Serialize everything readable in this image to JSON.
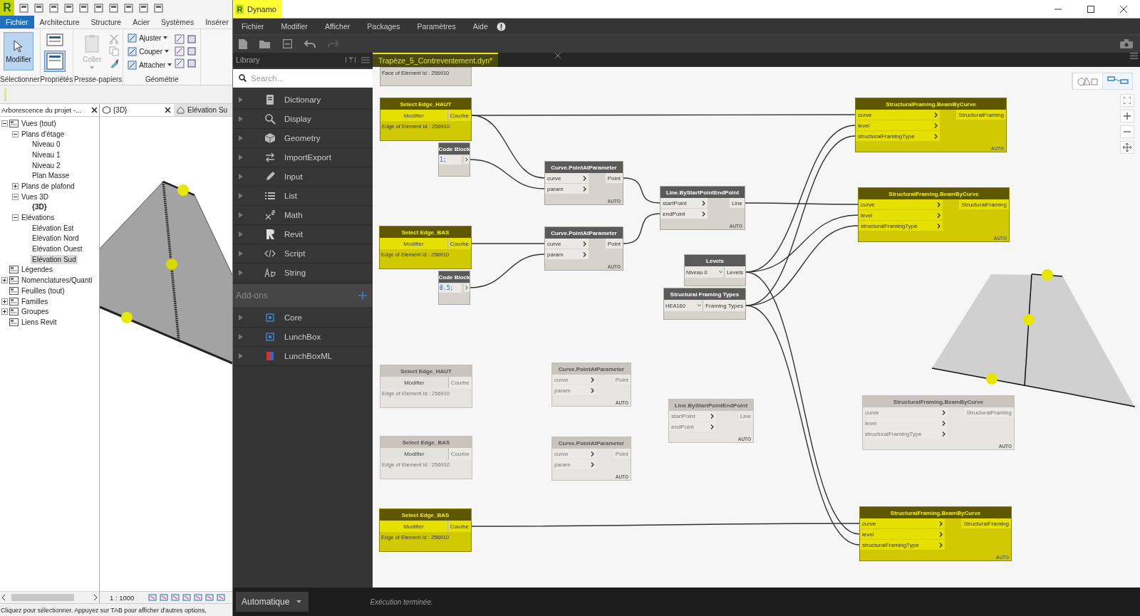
{
  "revit": {
    "logo": "R",
    "ribbon_tabs": [
      {
        "label": "Fichier",
        "selected": true
      },
      {
        "label": "Architecture",
        "selected": false
      },
      {
        "label": "Structure",
        "selected": false
      },
      {
        "label": "Acier",
        "selected": false
      },
      {
        "label": "Systèmes",
        "selected": false
      },
      {
        "label": "Insérer",
        "selected": false
      }
    ],
    "ribbon_panels": [
      {
        "kind": "select",
        "label": "Sélectionner",
        "tools": [
          {
            "label": "Modifier",
            "selected": true
          }
        ]
      },
      {
        "kind": "properties",
        "label": "Propriétés",
        "tools": [
          {
            "selected": false
          },
          {
            "selected": true
          }
        ]
      },
      {
        "kind": "clipboard",
        "label": "Presse-papiers",
        "tools": [
          {
            "label": "Coller",
            "disabled": true
          }
        ]
      },
      {
        "kind": "geometry",
        "label": "Géométrie",
        "tools": [
          {
            "label": "Ajuster"
          },
          {
            "label": "Couper"
          },
          {
            "label": "Attacher"
          }
        ]
      }
    ],
    "project_browser": {
      "title": "Arborescence du projet -...",
      "tree": [
        {
          "label": "Vues (tout)",
          "expanded": true,
          "selected": false,
          "current": false,
          "children": [
            {
              "label": "Plans d'étage",
              "expanded": true,
              "selected": false,
              "current": false,
              "children": [
                {
                  "label": "Niveau 0",
                  "selected": false,
                  "current": false
                },
                {
                  "label": "Niveau 1",
                  "selected": false,
                  "current": false
                },
                {
                  "label": "Niveau 2",
                  "selected": false,
                  "current": false
                },
                {
                  "label": "Plan Masse",
                  "selected": false,
                  "current": false
                }
              ]
            },
            {
              "label": "Plans de plafond",
              "expanded": false,
              "selected": false,
              "current": false
            },
            {
              "label": "Vues 3D",
              "expanded": true,
              "selected": false,
              "current": false,
              "children": [
                {
                  "label": "{3D}",
                  "selected": false,
                  "current": true
                }
              ]
            },
            {
              "label": "Elévations",
              "expanded": true,
              "selected": false,
              "current": false,
              "children": [
                {
                  "label": "Elévation Est",
                  "selected": false,
                  "current": false
                },
                {
                  "label": "Elévation Nord",
                  "selected": false,
                  "current": false
                },
                {
                  "label": "Elévation Ouest",
                  "selected": false,
                  "current": false
                },
                {
                  "label": "Elévation Sud",
                  "selected": true,
                  "current": false
                }
              ]
            }
          ]
        },
        {
          "label": "Légendes",
          "selected": false,
          "current": false
        },
        {
          "label": "Nomenclatures/Quanti",
          "expanded": false,
          "selected": false,
          "current": false
        },
        {
          "label": "Feuilles (tout)",
          "selected": false,
          "current": false
        },
        {
          "label": "Familles",
          "expanded": false,
          "selected": false,
          "current": false
        },
        {
          "label": "Groupes",
          "expanded": false,
          "selected": false,
          "current": false
        },
        {
          "label": "Liens Revit",
          "selected": false,
          "current": false
        }
      ]
    },
    "view_tabs": [
      {
        "label": "{3D}",
        "selected": true
      },
      {
        "label": "Elévation Su",
        "selected": false
      }
    ],
    "view_scale": "1 : 1000",
    "status_text": "Cliquez pour sélectionner. Appuyez sur TAB pour afficher d'autres options,"
  },
  "dynamo": {
    "logo": "R",
    "title": "Dynamo",
    "menu": [
      "Fichier",
      "Modifier",
      "Afficher",
      "Packages",
      "Paramètres",
      "Aide"
    ],
    "library": {
      "title": "Library",
      "search_placeholder": "Search...",
      "categories": [
        "Dictionary",
        "Display",
        "Geometry",
        "ImportExport",
        "Input",
        "List",
        "Math",
        "Revit",
        "Script",
        "String"
      ],
      "addons_title": "Add-ons",
      "packages": [
        "Core",
        "LunchBox",
        "LunchBoxML"
      ]
    },
    "file_tab": {
      "label": "Trapèze_5_Contreventement.dyn*",
      "selected": true
    },
    "view_toggle": [
      {
        "selected": false
      },
      {
        "selected": true
      }
    ],
    "nodes": [
      {
        "kind": "partial",
        "selected": false,
        "inactive": false,
        "info": "Face of Element Id : 256910"
      },
      {
        "kind": "select",
        "title": "Select Edge_HAUT",
        "selected": true,
        "inactive": false,
        "button": "Modifier",
        "outputs": [
          "Courbe"
        ],
        "info": "Edge of Element Id : 256910"
      },
      {
        "kind": "code",
        "title": "Code Block",
        "selected": false,
        "inactive": false,
        "code": "1;"
      },
      {
        "kind": "function",
        "title": "Curve.PointAtParameter",
        "selected": false,
        "inactive": false,
        "inputs": [
          "curve",
          "param"
        ],
        "outputs": [
          "Point"
        ],
        "lacing": "AUTO"
      },
      {
        "kind": "function",
        "title": "Line.ByStartPointEndPoint",
        "selected": false,
        "inactive": false,
        "inputs": [
          "startPoint",
          "endPoint"
        ],
        "outputs": [
          "Line"
        ],
        "lacing": "AUTO"
      },
      {
        "kind": "select",
        "title": "Select Edge_BAS",
        "selected": true,
        "inactive": false,
        "button": "Modifier",
        "outputs": [
          "Courbe"
        ],
        "info": "Edge of Element Id : 256910"
      },
      {
        "kind": "function",
        "title": "Curve.PointAtParameter",
        "selected": false,
        "inactive": false,
        "inputs": [
          "curve",
          "param"
        ],
        "outputs": [
          "Point"
        ],
        "lacing": "AUTO"
      },
      {
        "kind": "code",
        "title": "Code Block",
        "selected": false,
        "inactive": false,
        "code": "0.5;"
      },
      {
        "kind": "dropdown",
        "title": "Levels",
        "selected": false,
        "inactive": false,
        "value": "Niveau 0",
        "outputs": [
          "Levels"
        ]
      },
      {
        "kind": "dropdown",
        "title": "Structural Framing Types",
        "selected": false,
        "inactive": false,
        "value": "HEA160",
        "outputs": [
          "Framing Types"
        ]
      },
      {
        "kind": "function",
        "title": "StructuralFraming.BeamByCurve",
        "selected": true,
        "inactive": false,
        "inputs": [
          "curve",
          "level",
          "structuralFramingType"
        ],
        "outputs": [
          "StructuralFraming"
        ],
        "lacing": "AUTO"
      },
      {
        "kind": "function",
        "title": "StructuralFraming.BeamByCurve",
        "selected": true,
        "inactive": false,
        "inputs": [
          "curve",
          "level",
          "structuralFramingType"
        ],
        "outputs": [
          "StructuralFraming"
        ],
        "lacing": "AUTO"
      },
      {
        "kind": "select",
        "title": "Select Edge_HAUT",
        "selected": false,
        "inactive": true,
        "button": "Modifier",
        "outputs": [
          "Courbe"
        ],
        "info": "Edge of Element Id : 256910"
      },
      {
        "kind": "function",
        "title": "Curve.PointAtParameter",
        "selected": false,
        "inactive": true,
        "inputs": [
          "curve",
          "param"
        ],
        "outputs": [
          "Point"
        ],
        "lacing": "AUTO"
      },
      {
        "kind": "function",
        "title": "Line.ByStartPointEndPoint",
        "selected": false,
        "inactive": true,
        "inputs": [
          "startPoint",
          "endPoint"
        ],
        "outputs": [
          "Line"
        ],
        "lacing": "AUTO"
      },
      {
        "kind": "select",
        "title": "Select Edge_BAS",
        "selected": false,
        "inactive": true,
        "button": "Modifier",
        "outputs": [
          "Courbe"
        ],
        "info": "Edge of Element Id : 256910"
      },
      {
        "kind": "function",
        "title": "Curve.PointAtParameter",
        "selected": false,
        "inactive": true,
        "inputs": [
          "curve",
          "param"
        ],
        "outputs": [
          "Point"
        ],
        "lacing": "AUTO"
      },
      {
        "kind": "function",
        "title": "StructuralFraming.BeamByCurve",
        "selected": false,
        "inactive": true,
        "inputs": [
          "curve",
          "level",
          "structuralFramingType"
        ],
        "outputs": [
          "StructuralFraming"
        ],
        "lacing": "AUTO"
      },
      {
        "kind": "select",
        "title": "Select Edge_BAS",
        "selected": true,
        "inactive": false,
        "button": "Modifier",
        "outputs": [
          "Courbe"
        ],
        "info": "Edge of Element Id : 256910"
      },
      {
        "kind": "function",
        "title": "StructuralFraming.BeamByCurve",
        "selected": true,
        "inactive": false,
        "inputs": [
          "curve",
          "level",
          "structuralFramingType"
        ],
        "outputs": [
          "StructuralFraming"
        ],
        "lacing": "AUTO"
      }
    ],
    "run_mode": "Automatique",
    "run_status": "Exécution terminée."
  }
}
